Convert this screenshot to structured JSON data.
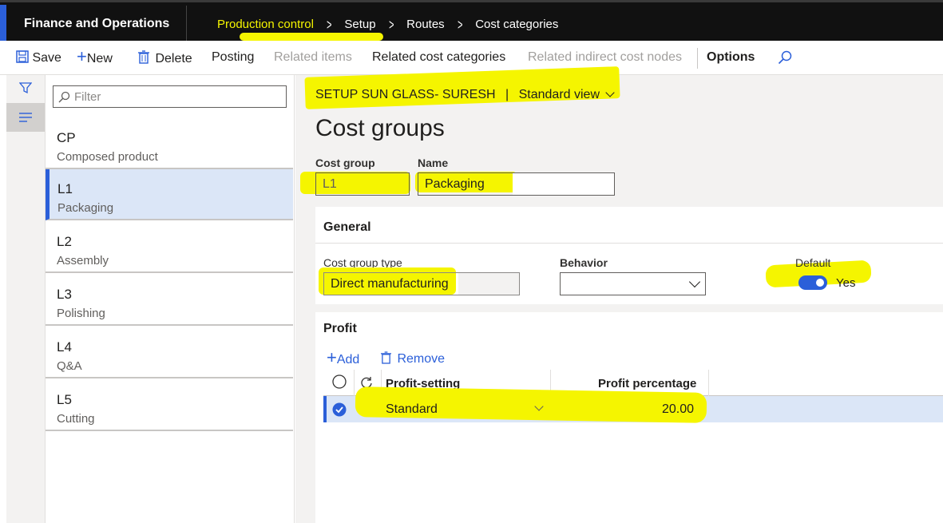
{
  "app": {
    "title": "Finance and Operations"
  },
  "breadcrumb": [
    "Production control",
    "Setup",
    "Routes",
    "Cost categories"
  ],
  "toolbar": {
    "save": "Save",
    "new": "New",
    "delete": "Delete",
    "posting": "Posting",
    "related_items": "Related items",
    "related_cost_categories": "Related cost categories",
    "related_indirect_cost_nodes": "Related indirect cost nodes",
    "options": "Options"
  },
  "list": {
    "filter_placeholder": "Filter",
    "items": [
      {
        "code": "CP",
        "name": "Composed product"
      },
      {
        "code": "L1",
        "name": "Packaging"
      },
      {
        "code": "L2",
        "name": "Assembly"
      },
      {
        "code": "L3",
        "name": "Polishing"
      },
      {
        "code": "L4",
        "name": "Q&A"
      },
      {
        "code": "L5",
        "name": "Cutting"
      }
    ]
  },
  "record": {
    "view_title": "SETUP SUN GLASS- SURESH",
    "view_separator": "|",
    "view_name": "Standard view",
    "page_title": "Cost groups",
    "cost_group_label": "Cost group",
    "cost_group_value": "L1",
    "name_label": "Name",
    "name_value": "Packaging"
  },
  "general": {
    "title": "General",
    "cost_group_type_label": "Cost group type",
    "cost_group_type_value": "Direct manufacturing",
    "behavior_label": "Behavior",
    "behavior_value": "",
    "default_label": "Default",
    "default_value": "Yes"
  },
  "profit": {
    "title": "Profit",
    "add": "Add",
    "remove": "Remove",
    "columns": {
      "setting": "Profit-setting",
      "percentage": "Profit percentage"
    },
    "rows": [
      {
        "setting": "Standard",
        "percentage": "20.00"
      }
    ]
  },
  "colors": {
    "accent": "#2b5fd9",
    "highlight": "#f5f500",
    "topbar": "#111111"
  },
  "icons": [
    "save-icon",
    "plus-icon",
    "trash-icon",
    "search-icon",
    "filter-icon",
    "list-icon",
    "chevron-down-icon",
    "refresh-icon",
    "check-circle-icon"
  ]
}
